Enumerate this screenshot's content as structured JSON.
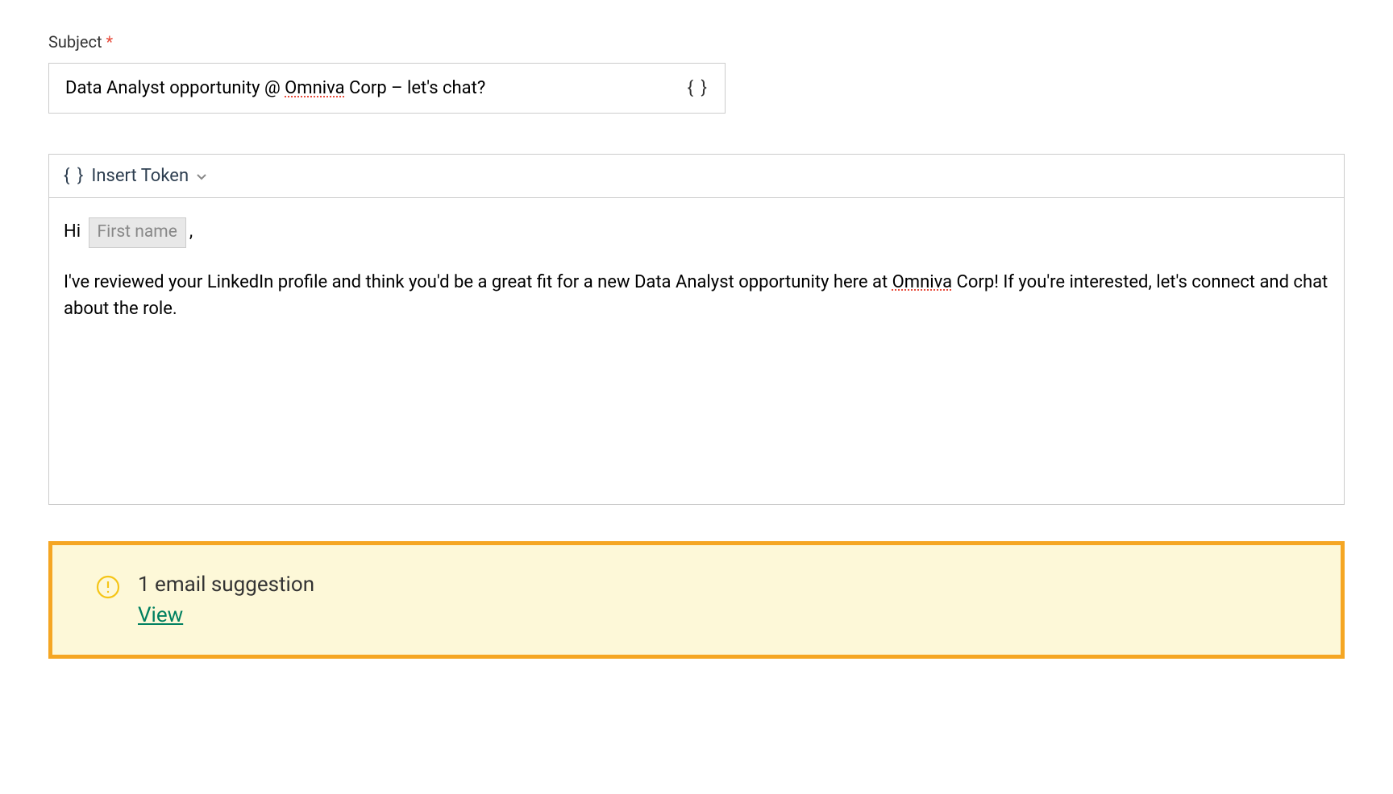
{
  "subject": {
    "label": "Subject",
    "required_marker": "*",
    "value_before_spell1": "Data Analyst opportunity @ ",
    "spell1": "Omniva",
    "value_after_spell1": " Corp – let's chat?",
    "token_icon": "{ }"
  },
  "editor": {
    "toolbar": {
      "braces": "{ }",
      "insert_token_label": "Insert Token"
    },
    "greeting_prefix": "Hi",
    "token_chip_label": "First name",
    "greeting_suffix": ",",
    "body_before_spell": "I've reviewed your LinkedIn profile and think you'd be a great fit for a new Data Analyst opportunity here at ",
    "body_spell": "Omniva",
    "body_after_spell": " Corp! If you're interested, let's connect and chat about the role."
  },
  "suggestion": {
    "title": "1 email suggestion",
    "link_label": "View"
  }
}
